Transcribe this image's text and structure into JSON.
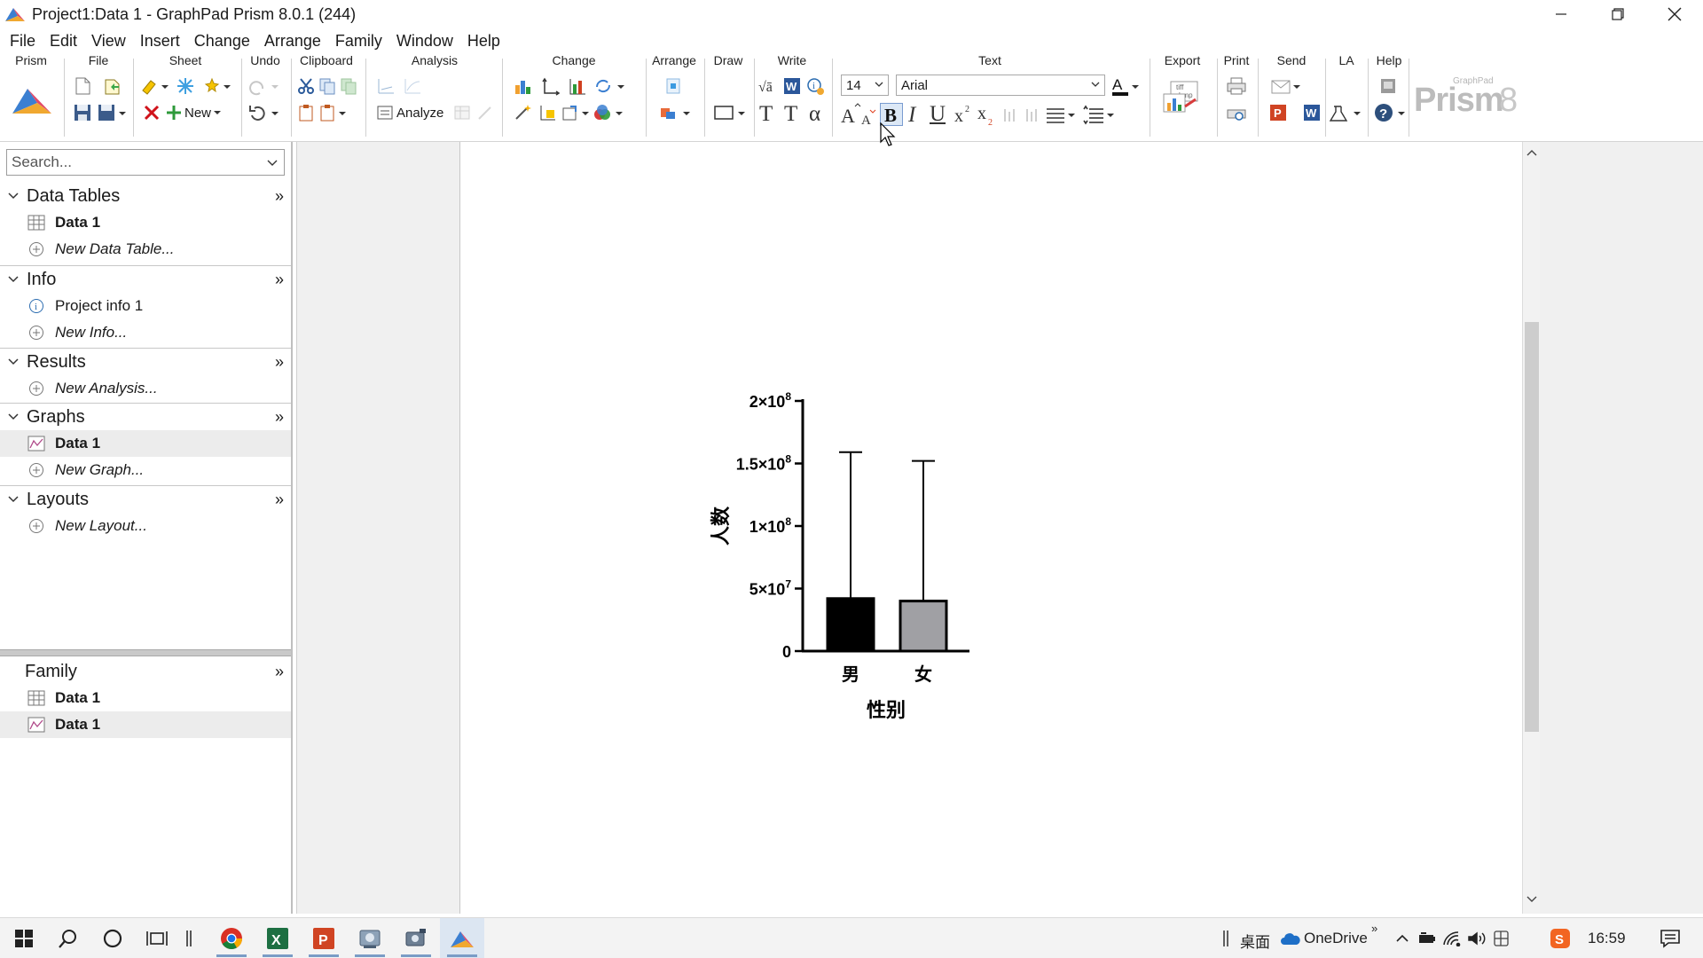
{
  "window": {
    "title": "Project1:Data 1 - GraphPad Prism 8.0.1 (244)",
    "controls": [
      "minimize-icon",
      "restore-icon",
      "close-icon"
    ]
  },
  "menubar": [
    "File",
    "Edit",
    "View",
    "Insert",
    "Change",
    "Arrange",
    "Family",
    "Window",
    "Help"
  ],
  "ribbon": {
    "groups": [
      "Prism",
      "File",
      "Sheet",
      "Undo",
      "Clipboard",
      "Analysis",
      "Change",
      "Arrange",
      "Draw",
      "Write",
      "Text",
      "Export",
      "Print",
      "Send",
      "LA",
      "Help"
    ],
    "new_label": "New",
    "analyze_label": "Analyze",
    "font_size": "14",
    "font_name": "Arial",
    "logo_small": "GraphPad",
    "logo_big": "Prism",
    "logo_num": "8",
    "export_tiff": "tiff",
    "export_bmp": "bmp"
  },
  "navigator": {
    "search_placeholder": "Search...",
    "sections": {
      "data_tables": {
        "title": "Data Tables",
        "items": [
          "Data 1",
          "New Data Table..."
        ]
      },
      "info": {
        "title": "Info",
        "items": [
          "Project info 1",
          "New Info..."
        ]
      },
      "results": {
        "title": "Results",
        "items": [
          "New Analysis..."
        ]
      },
      "graphs": {
        "title": "Graphs",
        "items": [
          "Data 1",
          "New Graph..."
        ]
      },
      "layouts": {
        "title": "Layouts",
        "items": [
          "New Layout..."
        ]
      }
    },
    "family": {
      "title": "Family",
      "items": [
        "Data 1",
        "Data 1"
      ]
    },
    "more_glyph": "»"
  },
  "chart_data": {
    "type": "bar",
    "categories": [
      "男",
      "女"
    ],
    "values": [
      42000000,
      40000000
    ],
    "error_upper": [
      159000000,
      152000000
    ],
    "colors": [
      "#000000",
      "#a0a0a4"
    ],
    "xlabel": "性别",
    "ylabel": "人数",
    "ylim": [
      0,
      200000000
    ],
    "yticks": [
      {
        "value": 0,
        "base": "0",
        "exp": ""
      },
      {
        "value": 50000000,
        "base": "5×10",
        "exp": "7"
      },
      {
        "value": 100000000,
        "base": "1×10",
        "exp": "8"
      },
      {
        "value": 150000000,
        "base": "1.5×10",
        "exp": "8"
      },
      {
        "value": 200000000,
        "base": "2×10",
        "exp": "8"
      }
    ]
  },
  "taskbar": {
    "desktop_label": "桌面",
    "onedrive_label": "OneDrive",
    "time": "16:59"
  }
}
